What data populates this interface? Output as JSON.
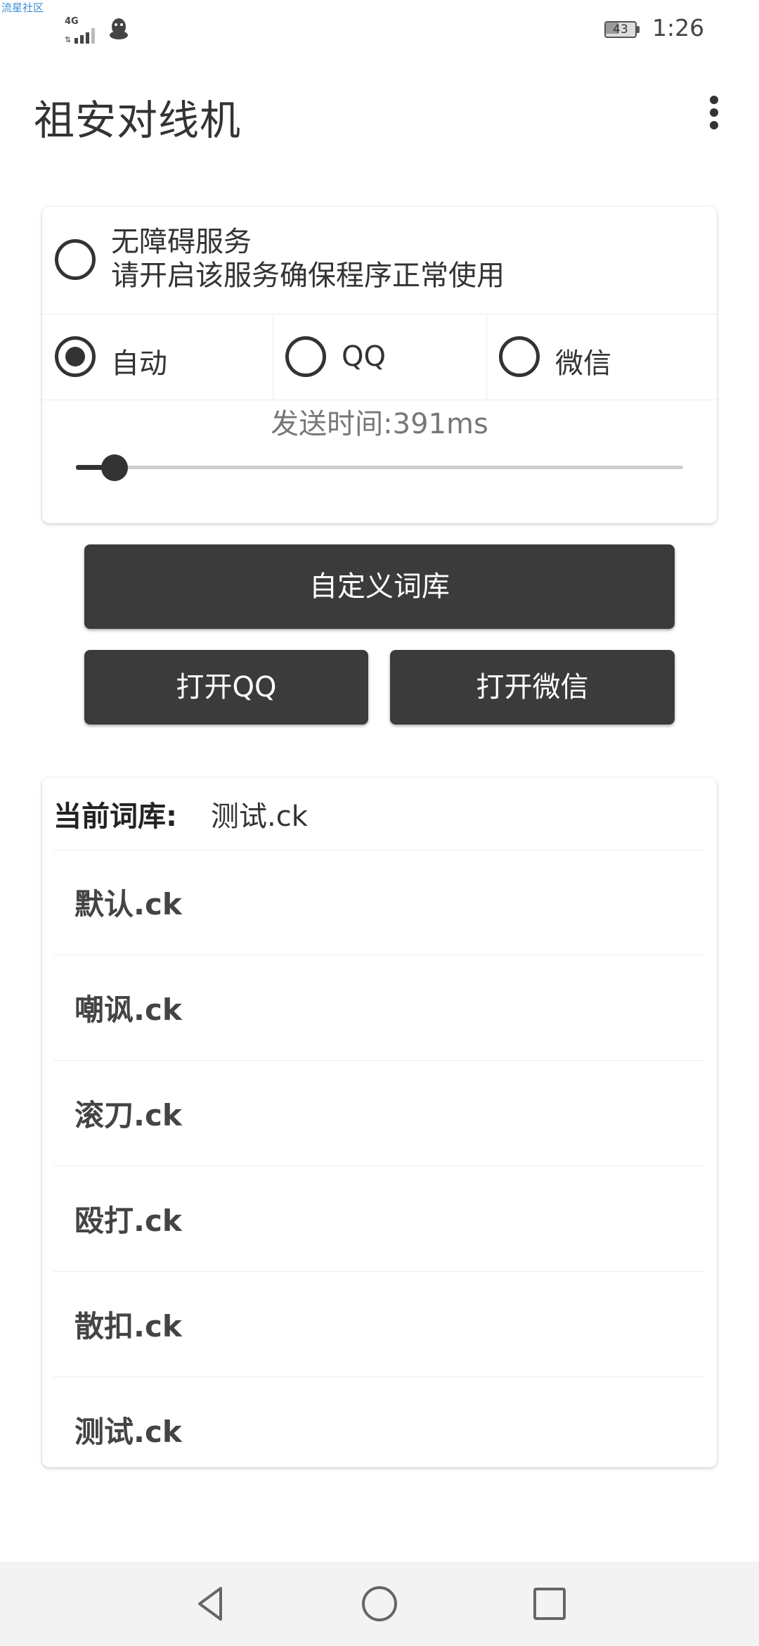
{
  "watermark": "流星社区",
  "status_bar": {
    "network": "4G",
    "battery": "43",
    "battery_fraction": 0.43,
    "time": "1:26",
    "icons": [
      "signal-icon",
      "qq-penguin-icon",
      "battery-icon"
    ]
  },
  "app_bar": {
    "title": "祖安对线机",
    "menu_icon": "more-vert-icon"
  },
  "accessibility": {
    "title": "无障碍服务",
    "description": "请开启该服务确保程序正常使用",
    "checked": false
  },
  "modes": {
    "selected": "auto",
    "options": [
      {
        "id": "auto",
        "label": "自动"
      },
      {
        "id": "qq",
        "label": "QQ"
      },
      {
        "id": "wechat",
        "label": "微信"
      }
    ]
  },
  "send_time": {
    "label": "发送时间:391ms",
    "slider_fraction": 0.05
  },
  "buttons": {
    "custom_library": "自定义词库",
    "open_qq": "打开QQ",
    "open_wechat": "打开微信"
  },
  "library": {
    "current_label": "当前词库:",
    "current_value": "测试.ck",
    "items": [
      "默认.ck",
      "嘲讽.ck",
      "滚刀.ck",
      "殴打.ck",
      "散扣.ck",
      "测试.ck"
    ]
  },
  "navigation": {
    "icons": [
      "back-icon",
      "home-icon",
      "recents-icon"
    ]
  },
  "colors": {
    "primary_dark": "#3b3b3b",
    "background": "#ffffff",
    "nav_background": "#f3f3f3"
  }
}
